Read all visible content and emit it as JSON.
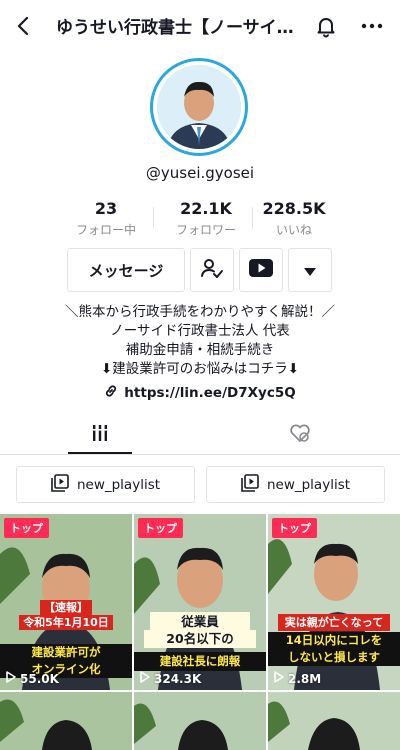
{
  "header": {
    "title": "ゆうせい行政書士【ノーサイド行政書士法人】",
    "back_icon": "chevron-left-icon",
    "bell_icon": "bell-icon",
    "more_icon": "more-horizontal-icon"
  },
  "profile": {
    "username": "@yusei.gyosei",
    "ring_color": "#29a7e0"
  },
  "stats": [
    {
      "value": "23",
      "label": "フォロー中"
    },
    {
      "value": "22.1K",
      "label": "フォロワー"
    },
    {
      "value": "228.5K",
      "label": "いいね"
    }
  ],
  "actions": {
    "message_label": "メッセージ",
    "follow_icon": "person-check-icon",
    "youtube_icon": "youtube-icon",
    "dropdown_icon": "triangle-down-icon"
  },
  "bio": {
    "line1": "＼熊本から行政手続をわかりやすく解説！／",
    "line2": "ノーサイド行政書士法人 代表",
    "line3": "補助金申請・相続手続き",
    "line4": "⬇建設業許可のお悩みはコチラ⬇",
    "link": "https://lin.ee/D7Xyc5Q"
  },
  "tabs": {
    "videos_icon": "grid-icon",
    "liked_icon": "heart-hidden-icon"
  },
  "playlists": [
    {
      "label": "new_playlist"
    },
    {
      "label": "new_playlist"
    }
  ],
  "videos": [
    {
      "badge": "トップ",
      "plays": "55.0K",
      "caption1": "【速報】",
      "caption2": "令和5年1月10日",
      "caption3": "建設業許可が",
      "caption4": "オンライン化"
    },
    {
      "badge": "トップ",
      "plays": "324.3K",
      "caption1": "従業員",
      "caption2": "20名以下の",
      "caption3": "建設社長に朗報",
      "caption4": ""
    },
    {
      "badge": "トップ",
      "plays": "2.8M",
      "caption1": "実は親が亡くなって",
      "caption2": "14日以内にコレを",
      "caption3": "しないと損します",
      "caption4": ""
    }
  ],
  "colors": {
    "accent": "#fe2c55",
    "text": "#161823",
    "muted": "#8a8b91",
    "border": "#e3e3e4"
  }
}
